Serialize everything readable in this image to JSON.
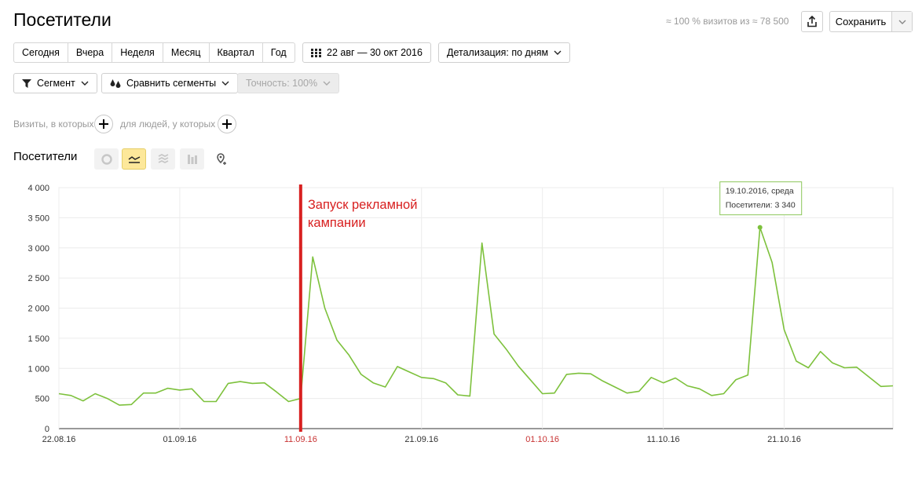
{
  "header": {
    "title": "Посетители",
    "visits_info": "≈ 100 % визитов из ≈ 78 500",
    "save_label": "Сохранить"
  },
  "period_tabs": [
    "Сегодня",
    "Вчера",
    "Неделя",
    "Месяц",
    "Квартал",
    "Год"
  ],
  "date_range": "22 авг — 30 окт 2016",
  "detail": "Детализация: по дням",
  "segment": "Сегмент",
  "compare": "Сравнить сегменты",
  "accuracy": "Точность: 100%",
  "filter": {
    "visits": "Визиты, в которых",
    "people": "для людей, у которых"
  },
  "chart_title": "Посетители",
  "colors": {
    "line": "#7dc13c",
    "marker": "#d82020",
    "weekend_label": "#c83232",
    "active_chart_type": "#fde89a"
  },
  "icons": [
    "share-icon",
    "chevron-down-icon",
    "calendar-icon",
    "filter-icon",
    "compare-icon",
    "plus-icon",
    "pie-chart-icon",
    "line-chart-icon",
    "area-chart-icon",
    "bar-chart-icon",
    "map-icon"
  ],
  "chart_data": {
    "type": "line",
    "ylim": [
      0,
      4000
    ],
    "y_ticks": [
      0,
      500,
      1000,
      1500,
      2000,
      2500,
      3000,
      3500,
      4000
    ],
    "y_tick_labels": [
      "0",
      "500",
      "1 000",
      "1 500",
      "2 000",
      "2 500",
      "3 000",
      "3 500",
      "4 000"
    ],
    "x_tick_labels": [
      {
        "label": "22.08.16",
        "index": 0,
        "red": false
      },
      {
        "label": "01.09.16",
        "index": 10,
        "red": false
      },
      {
        "label": "11.09.16",
        "index": 20,
        "red": true
      },
      {
        "label": "21.09.16",
        "index": 30,
        "red": false
      },
      {
        "label": "01.10.16",
        "index": 40,
        "red": true
      },
      {
        "label": "11.10.16",
        "index": 50,
        "red": false
      },
      {
        "label": "21.10.16",
        "index": 60,
        "red": false
      }
    ],
    "x_start": "2016-08-22",
    "x_end": "2016-10-30",
    "series": [
      {
        "values": [
          580,
          550,
          460,
          580,
          500,
          390,
          400,
          590,
          590,
          670,
          640,
          660,
          450,
          450,
          750,
          780,
          750,
          760,
          610,
          450,
          500,
          2850,
          2000,
          1470,
          1220,
          900,
          760,
          690,
          1030,
          940,
          850,
          830,
          760,
          560,
          540,
          3080,
          1570,
          1320,
          1040,
          810,
          580,
          590,
          900,
          920,
          910,
          790,
          690,
          590,
          620,
          850,
          760,
          840,
          710,
          660,
          550,
          580,
          810,
          890,
          3340,
          2760,
          1640,
          1120,
          1010,
          1280,
          1090,
          1010,
          1020,
          860,
          700,
          710
        ]
      }
    ],
    "annotation": {
      "text_line1": "Запуск рекламной",
      "text_line2": "кампании",
      "index": 20
    },
    "tooltip": {
      "line1": "19.10.2016, среда",
      "line2": "Посетители: 3 340",
      "index": 58
    }
  }
}
